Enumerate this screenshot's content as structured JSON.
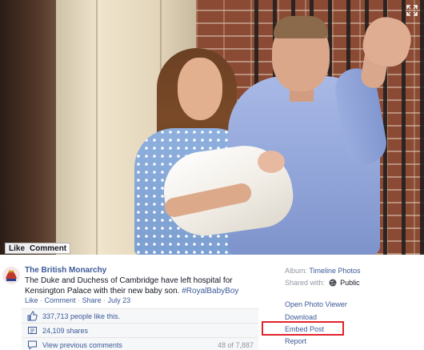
{
  "photo": {
    "actions": {
      "like": "Like",
      "comment": "Comment"
    }
  },
  "post": {
    "page_name": "The British Monarchy",
    "text": "The Duke and Duchess of Cambridge have left hospital for Kensington Palace with their new baby son.",
    "hashtag": "#RoyalBabyBoy",
    "meta": {
      "like": "Like",
      "comment": "Comment",
      "share": "Share",
      "date": "July 23",
      "separator": "·"
    }
  },
  "ufi": {
    "likes": "337,713 people like this.",
    "shares": "24,109 shares",
    "comments_link": "View previous comments",
    "comments_count": "48 of 7,887"
  },
  "sidebar": {
    "album_label": "Album:",
    "album_value": "Timeline Photos",
    "shared_label": "Shared with:",
    "shared_value": "Public",
    "menu": [
      "Open Photo Viewer",
      "Download",
      "Embed Post",
      "Report"
    ]
  },
  "colors": {
    "link": "#3b5998",
    "muted": "#9197a3",
    "highlight": "#e0252a"
  },
  "icons": [
    "expand-icon",
    "crest-icon",
    "thumbs-up-icon",
    "share-icon",
    "comment-icon",
    "globe-icon"
  ]
}
